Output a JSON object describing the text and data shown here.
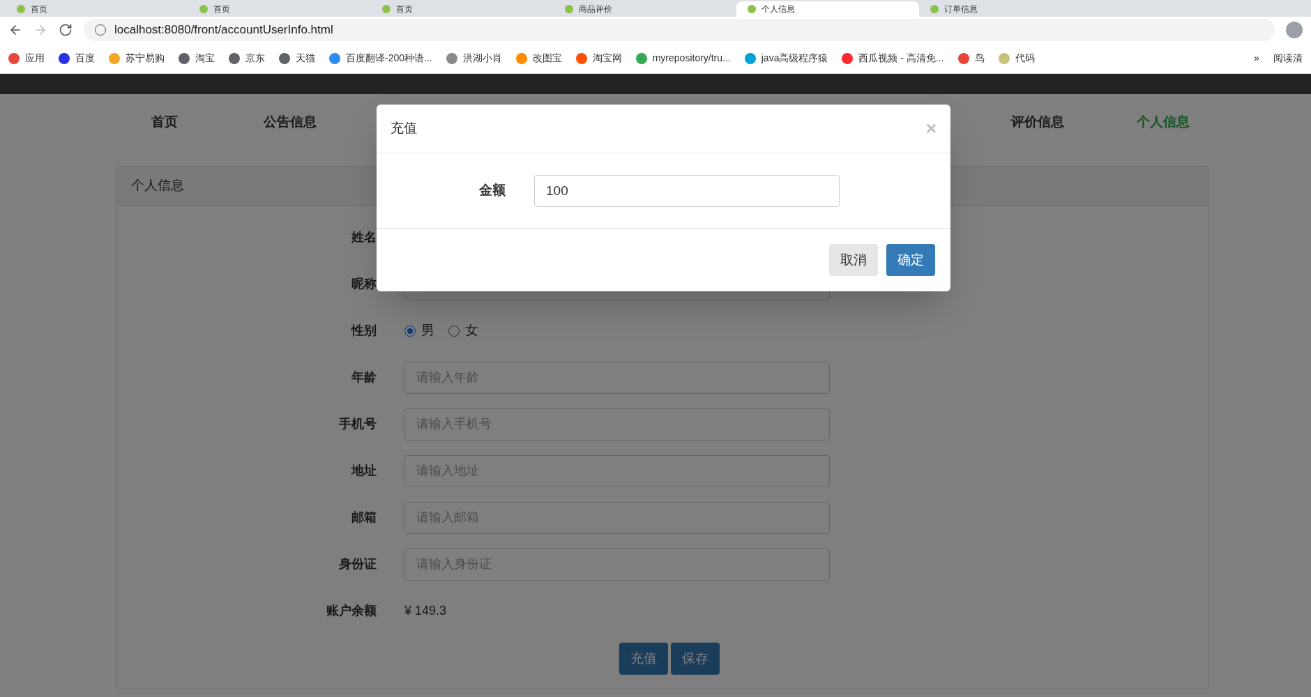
{
  "browser": {
    "tabs": [
      {
        "title": "首页",
        "selected": false
      },
      {
        "title": "首页",
        "selected": false
      },
      {
        "title": "首页",
        "selected": false
      },
      {
        "title": "商品评价",
        "selected": false
      },
      {
        "title": "个人信息",
        "selected": true
      },
      {
        "title": "订单信息",
        "selected": false
      }
    ],
    "url": "localhost:8080/front/accountUserInfo.html",
    "bookmarks": [
      {
        "label": "应用",
        "color": "#e8453c"
      },
      {
        "label": "百度",
        "color": "#2932e1"
      },
      {
        "label": "苏宁易购",
        "color": "#f5a623"
      },
      {
        "label": "淘宝",
        "color": "#5f6368"
      },
      {
        "label": "京东",
        "color": "#5f6368"
      },
      {
        "label": "天猫",
        "color": "#5f6368"
      },
      {
        "label": "百度翻译-200种语...",
        "color": "#2d8cf0"
      },
      {
        "label": "洪湖小肖",
        "color": "#8a8a8a"
      },
      {
        "label": "改图宝",
        "color": "#ff8c00"
      },
      {
        "label": "淘宝网",
        "color": "#ff5000"
      },
      {
        "label": "myrepository/tru...",
        "color": "#34a853"
      },
      {
        "label": "java高级程序猿",
        "color": "#00a1d6"
      },
      {
        "label": "西瓜视频 - 高清免...",
        "color": "#f72a32"
      },
      {
        "label": "鸟",
        "color": "#e8453c"
      },
      {
        "label": "代码",
        "color": "#c9c27a"
      }
    ],
    "more": "»",
    "reading_list": "阅读清"
  },
  "nav": [
    {
      "label": "首页",
      "selected": false
    },
    {
      "label": "公告信息",
      "selected": false
    },
    {
      "label": "评价信息",
      "selected": false
    },
    {
      "label": "个人信息",
      "selected": true
    }
  ],
  "card": {
    "title": "个人信息",
    "fields": [
      {
        "kind": "label",
        "label": "姓名"
      },
      {
        "kind": "input",
        "label": "昵称"
      },
      {
        "kind": "radio",
        "label": "性别",
        "options": [
          {
            "label": "男",
            "selected": true
          },
          {
            "label": "女",
            "selected": false
          }
        ]
      },
      {
        "kind": "input",
        "label": "年龄",
        "placeholder": "请输入年龄"
      },
      {
        "kind": "input",
        "label": "手机号",
        "placeholder": "请输入手机号"
      },
      {
        "kind": "input",
        "label": "地址",
        "placeholder": "请输入地址"
      },
      {
        "kind": "input",
        "label": "邮箱",
        "placeholder": "请输入邮箱"
      },
      {
        "kind": "input",
        "label": "身份证",
        "placeholder": "请输入身份证"
      },
      {
        "kind": "text",
        "label": "账户余额",
        "value": "¥ 149.3"
      }
    ],
    "buttons": [
      "充值",
      "保存"
    ]
  },
  "modal": {
    "title": "充值",
    "close": "×",
    "field": {
      "label": "金额",
      "value": "100"
    },
    "cancel": "取消",
    "confirm": "确定"
  }
}
